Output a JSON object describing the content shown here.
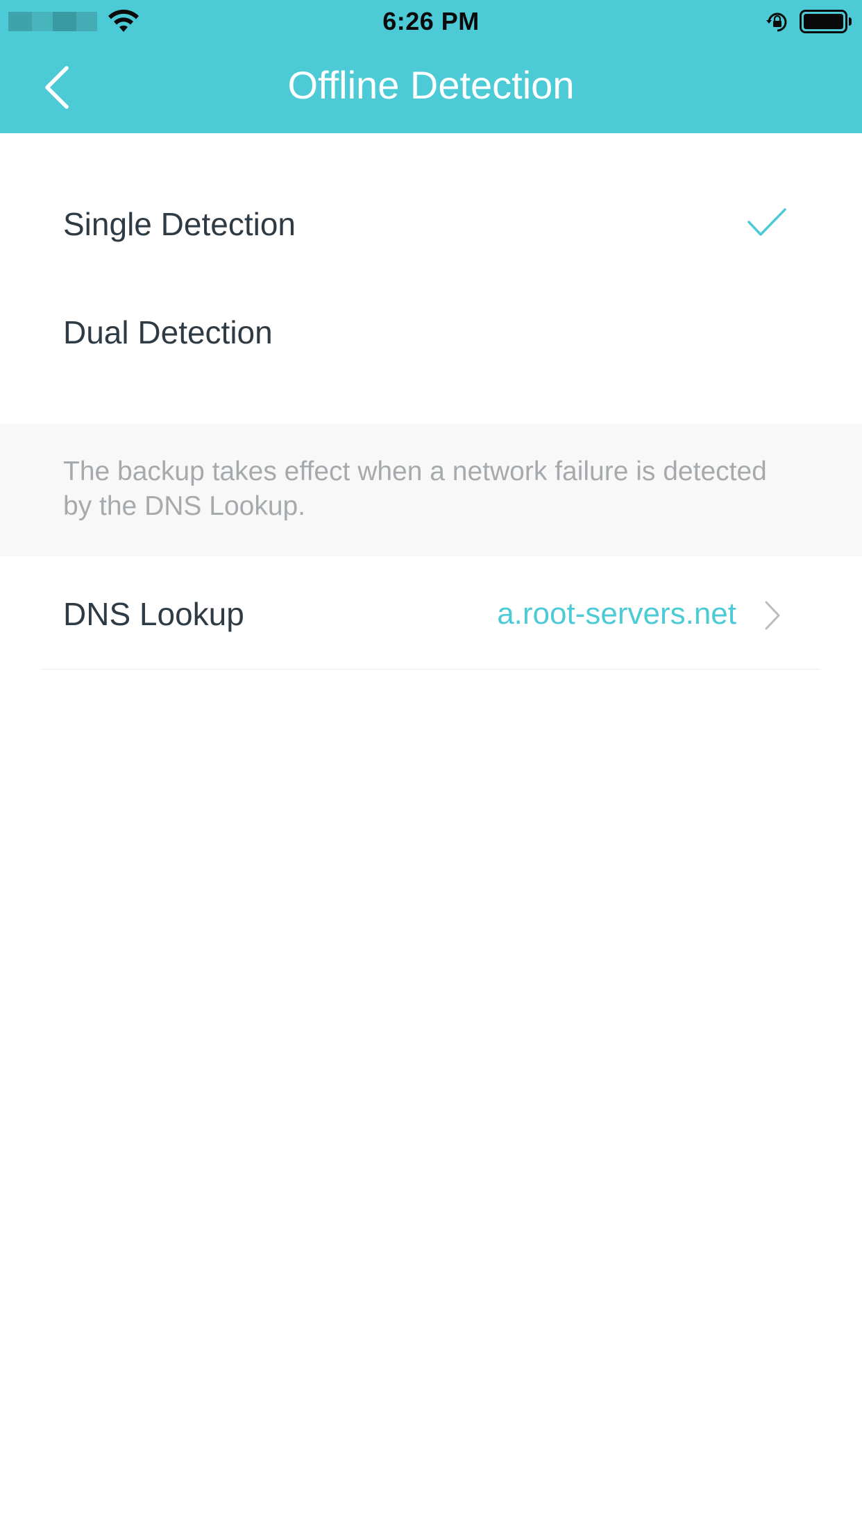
{
  "status_bar": {
    "time": "6:26 PM"
  },
  "nav": {
    "title": "Offline Detection",
    "back_icon": "chevron-left-icon"
  },
  "options": [
    {
      "label": "Single Detection",
      "selected": true
    },
    {
      "label": "Dual Detection",
      "selected": false
    }
  ],
  "info": {
    "text": "The backup takes effect when a network failure is detected by the DNS Lookup."
  },
  "dns": {
    "label": "DNS Lookup",
    "value": "a.root-servers.net"
  },
  "colors": {
    "accent": "#4ccbd6",
    "text_primary": "#2f3b44",
    "text_muted": "#a6aaad",
    "note_background": "#f8f8f8"
  }
}
